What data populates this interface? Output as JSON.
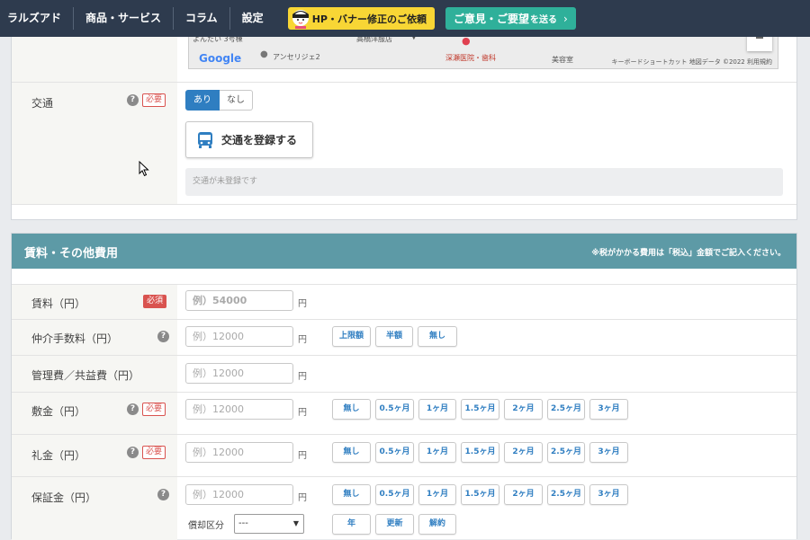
{
  "nav": {
    "items": [
      "ラルズアド",
      "商品・サービス",
      "コラム",
      "設定"
    ],
    "hp_button": "HP・バナー修正のご依頼",
    "opinion_button": {
      "main1": "ご意見",
      "mid": "・",
      "main2": "ご要望",
      "small": "を送る"
    }
  },
  "map": {
    "labels": [
      "高橋洋服店",
      "深瀬医院・歯科",
      "アンセリジェ2",
      "美容室",
      "よんたい 3号棟"
    ],
    "logo": "Google",
    "footer": "キーボードショートカット   地図データ ©2022   利用規約"
  },
  "transit": {
    "label": "交通",
    "required": "必要",
    "toggle_on": "あり",
    "toggle_off": "なし",
    "register_button": "交通を登録する",
    "status": "交通が未登録です"
  },
  "fees": {
    "section_title": "賃料・その他費用",
    "section_note": "※税がかかる費用は「税込」金額でご記入ください。",
    "unit": "円",
    "rows": [
      {
        "label": "賃料（円）",
        "badge": "必須",
        "placeholder": "例）54000"
      },
      {
        "label": "仲介手数料（円）",
        "placeholder": "例）12000",
        "buttons": [
          "上限額",
          "半額",
          "無し"
        ]
      },
      {
        "label": "管理費／共益費（円）",
        "placeholder": "例）12000"
      },
      {
        "label": "敷金（円）",
        "badge": "必要",
        "placeholder": "例）12000",
        "buttons": [
          "無し",
          "0.5ヶ月",
          "1ヶ月",
          "1.5ヶ月",
          "2ヶ月",
          "2.5ヶ月",
          "3ヶ月"
        ]
      },
      {
        "label": "礼金（円）",
        "badge": "必要",
        "placeholder": "例）12000",
        "buttons": [
          "無し",
          "0.5ヶ月",
          "1ヶ月",
          "1.5ヶ月",
          "2ヶ月",
          "2.5ヶ月",
          "3ヶ月"
        ]
      },
      {
        "label": "保証金（円）",
        "placeholder": "例）12000",
        "buttons": [
          "無し",
          "0.5ヶ月",
          "1ヶ月",
          "1.5ヶ月",
          "2ヶ月",
          "2.5ヶ月",
          "3ヶ月"
        ]
      }
    ],
    "amortization": {
      "label": "償却区分",
      "selected": "---",
      "buttons": [
        "年",
        "更新",
        "解約"
      ]
    }
  },
  "icons": {
    "help": "question-circle-icon",
    "bus": "bus-icon",
    "cursor": "mouse-pointer-icon",
    "map_pin": "map-pin-icon"
  },
  "colors": {
    "nav_bg": "#2e3b4e",
    "hp_yellow": "#f8d635",
    "opinion_teal": "#2fb09a",
    "section_head": "#5d9aa6",
    "required_red": "#d9534f",
    "button_blue": "#2f7ec1"
  }
}
